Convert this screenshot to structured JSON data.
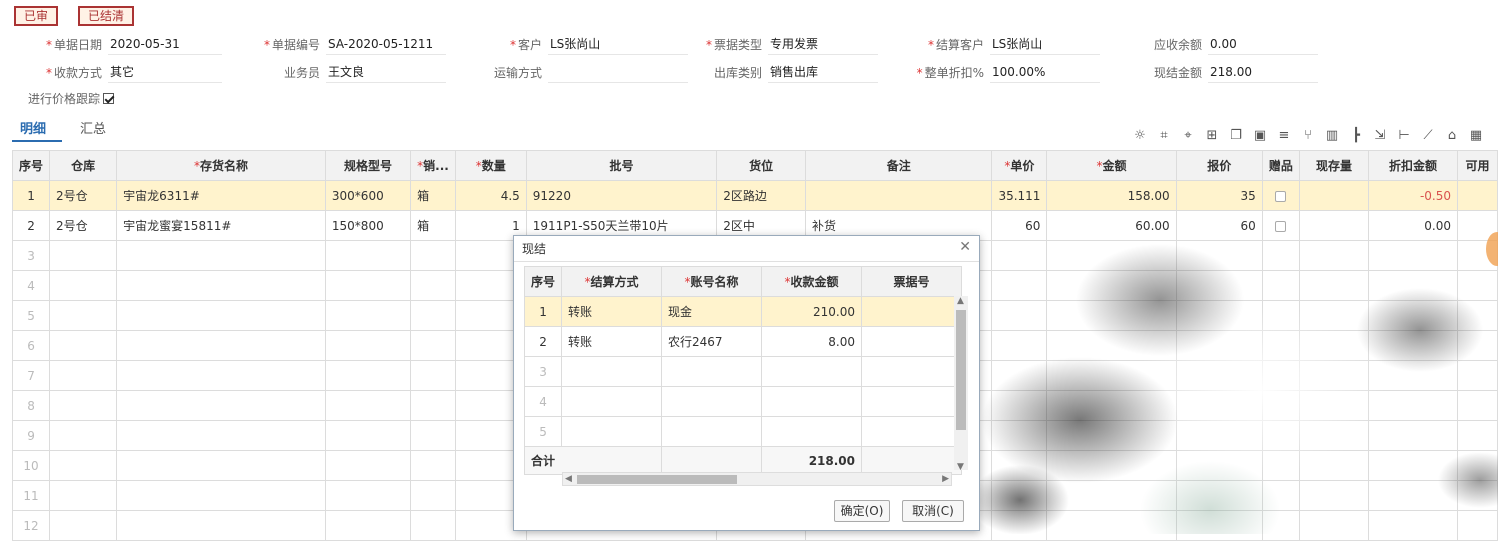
{
  "stamps": {
    "audited": "已审",
    "settled": "已结清"
  },
  "form": {
    "row1": [
      {
        "label": "单据日期",
        "req": true,
        "value": "2020-05-31"
      },
      {
        "label": "单据编号",
        "req": true,
        "value": "SA-2020-05-1211"
      },
      {
        "label": "客户",
        "req": true,
        "value": "LS张尚山"
      },
      {
        "label": "票据类型",
        "req": true,
        "value": "专用发票"
      },
      {
        "label": "结算客户",
        "req": true,
        "value": "LS张尚山"
      },
      {
        "label": "应收余额",
        "req": false,
        "value": "0.00"
      }
    ],
    "row2": [
      {
        "label": "收款方式",
        "req": true,
        "value": "其它"
      },
      {
        "label": "业务员",
        "req": false,
        "value": "王文良"
      },
      {
        "label": "运输方式",
        "req": false,
        "value": ""
      },
      {
        "label": "出库类别",
        "req": false,
        "value": "销售出库"
      },
      {
        "label": "整单折扣%",
        "req": true,
        "value": "100.00%"
      },
      {
        "label": "现结金额",
        "req": false,
        "value": "218.00"
      }
    ],
    "price_tracking_label": "进行价格跟踪",
    "price_tracking_checked": true
  },
  "tabs": [
    "明细",
    "汇总"
  ],
  "toolbar_icons": [
    "bulb-icon",
    "scan-icon",
    "location-icon",
    "copy-add-icon",
    "paste-icon",
    "image-icon",
    "list-sort-icon",
    "split-icon",
    "chart-icon",
    "tree-icon",
    "export-icon",
    "branch-icon",
    "ruler-icon",
    "home-icon",
    "grid-icon"
  ],
  "grid": {
    "headers": [
      {
        "label": "序号",
        "req": false
      },
      {
        "label": "仓库",
        "req": false
      },
      {
        "label": "存货名称",
        "req": true
      },
      {
        "label": "规格型号",
        "req": false
      },
      {
        "label": "销...",
        "req": true
      },
      {
        "label": "数量",
        "req": true
      },
      {
        "label": "批号",
        "req": false
      },
      {
        "label": "货位",
        "req": false
      },
      {
        "label": "备注",
        "req": false
      },
      {
        "label": "单价",
        "req": true
      },
      {
        "label": "金额",
        "req": true
      },
      {
        "label": "报价",
        "req": false
      },
      {
        "label": "赠品",
        "req": false
      },
      {
        "label": "现存量",
        "req": false
      },
      {
        "label": "折扣金额",
        "req": false
      },
      {
        "label": "可用",
        "req": false
      }
    ],
    "rows": [
      {
        "idx": "1",
        "wh": "2号仓",
        "name": "宇宙龙6311#",
        "spec": "300*600",
        "unit": "箱",
        "qty": "4.5",
        "batch": "91220",
        "loc": "2区路边",
        "note": "",
        "price": "35.111",
        "amount": "158.00",
        "quote": "35",
        "stock": "",
        "discount": "-0.50"
      },
      {
        "idx": "2",
        "wh": "2号仓",
        "name": "宇宙龙蜜宴15811#",
        "spec": "150*800",
        "unit": "箱",
        "qty": "1",
        "batch": "1911P1-S50天兰带10片",
        "loc": "2区中",
        "note": "补货",
        "price": "60",
        "amount": "60.00",
        "quote": "60",
        "stock": "",
        "discount": "0.00"
      }
    ],
    "empty_rows": [
      "3",
      "4",
      "5",
      "6",
      "7",
      "8",
      "9",
      "10",
      "11",
      "12"
    ]
  },
  "dialog": {
    "title": "现结",
    "headers": [
      {
        "label": "序号",
        "req": false
      },
      {
        "label": "结算方式",
        "req": true
      },
      {
        "label": "账号名称",
        "req": true
      },
      {
        "label": "收款金额",
        "req": true
      },
      {
        "label": "票据号",
        "req": false
      }
    ],
    "rows": [
      {
        "idx": "1",
        "method": "转账",
        "account": "现金",
        "amount": "210.00",
        "ticket": ""
      },
      {
        "idx": "2",
        "method": "转账",
        "account": "农行2467",
        "amount": "8.00",
        "ticket": ""
      }
    ],
    "empty_rows": [
      "3",
      "4",
      "5"
    ],
    "total_label": "合计",
    "total_value": "218.00",
    "ok_label": "确定(O)",
    "cancel_label": "取消(C)"
  }
}
